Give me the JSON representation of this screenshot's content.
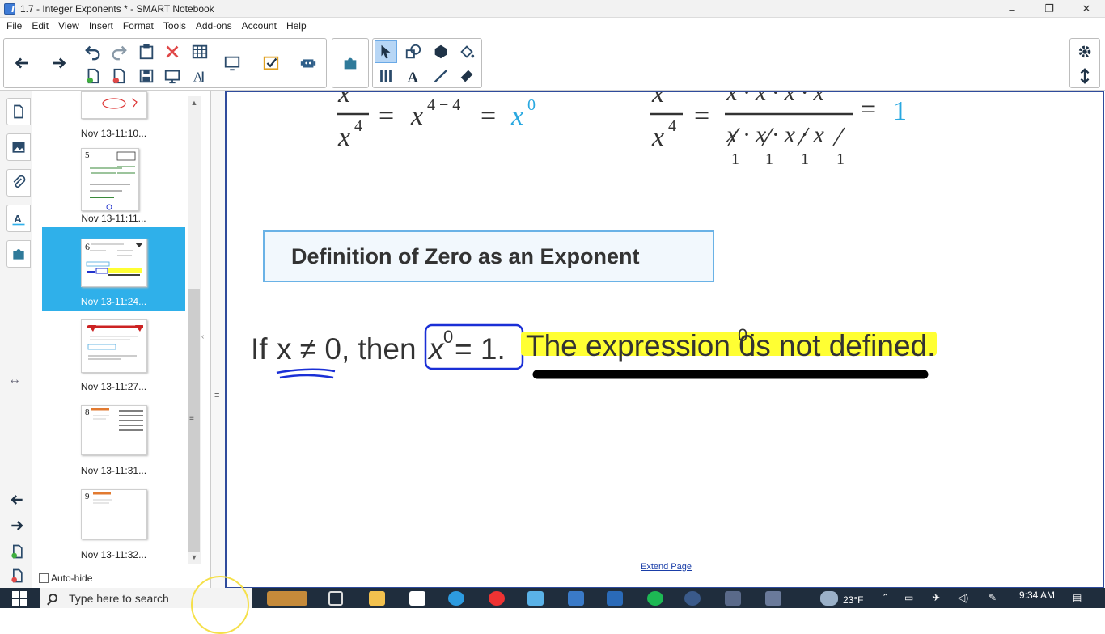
{
  "window": {
    "title": "1.7 - Integer Exponents * - SMART Notebook",
    "minimize": "–",
    "restore": "❐",
    "close": "✕"
  },
  "menu": [
    "File",
    "Edit",
    "View",
    "Insert",
    "Format",
    "Tools",
    "Add-ons",
    "Account",
    "Help"
  ],
  "sorter": {
    "pages": [
      {
        "label": "Nov 13-11:10...",
        "num": ""
      },
      {
        "label": "Nov 13-11:11...",
        "num": "5"
      },
      {
        "label": "Nov 13-11:24...",
        "num": "6"
      },
      {
        "label": "Nov 13-11:27...",
        "num": ""
      },
      {
        "label": "Nov 13-11:31...",
        "num": "8"
      },
      {
        "label": "Nov 13-11:32...",
        "num": "9"
      }
    ],
    "autohide_label": "Auto-hide"
  },
  "canvas": {
    "definition_title": "Definition of Zero as an Exponent",
    "sentence_if": "If",
    "sentence_cond": "x ≠ 0, then",
    "boxed": "x",
    "boxed_exp": "0",
    "boxed_rest": " = 1.",
    "statement_pre": "The expression 0",
    "statement_exp": "0",
    "statement_post": " is not defined.",
    "eq1_exp": "4 − 4",
    "eq1_result_base": "x",
    "eq1_result_exp": "0",
    "eq1_denom_exp": "4",
    "eq2_result": "1",
    "eq2_ones": [
      "1",
      "1",
      "1",
      "1"
    ],
    "extend_page": "Extend Page"
  },
  "taskbar": {
    "search_placeholder": "Type here to search",
    "temperature": "23°F",
    "time": "9:34 AM"
  },
  "colors": {
    "accent_blue": "#2fb0ea",
    "highlight": "#ffff33",
    "math_cyan": "#29a8e0",
    "ink_blue": "#1a2fd6"
  }
}
